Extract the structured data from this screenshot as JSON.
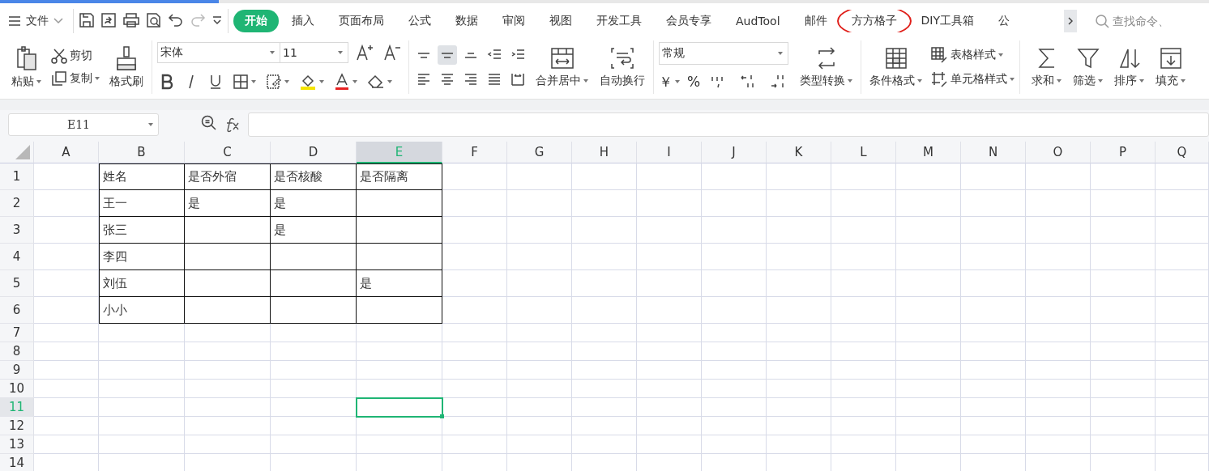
{
  "menu": {
    "label": "文件"
  },
  "tabs": [
    {
      "label": "开始",
      "selected": true
    },
    {
      "label": "插入",
      "selected": false
    },
    {
      "label": "页面布局",
      "selected": false
    },
    {
      "label": "公式",
      "selected": false
    },
    {
      "label": "数据",
      "selected": false
    },
    {
      "label": "审阅",
      "selected": false
    },
    {
      "label": "视图",
      "selected": false
    },
    {
      "label": "开发工具",
      "selected": false
    },
    {
      "label": "会员专享",
      "selected": false
    },
    {
      "label": "AudTool",
      "selected": false
    },
    {
      "label": "邮件",
      "selected": false
    },
    {
      "label": "方方格子",
      "selected": false,
      "circled": true
    },
    {
      "label": "DIY工具箱",
      "selected": false
    },
    {
      "label": "公",
      "selected": false
    }
  ],
  "search": {
    "placeholder": "查找命令、"
  },
  "ribbon": {
    "clipboard": {
      "paste": "粘贴",
      "cut": "剪切",
      "copy": "复制",
      "format_painter": "格式刷"
    },
    "font": {
      "name": "宋体",
      "size": "11"
    },
    "vertical_align": [
      {
        "selected": false
      },
      {
        "selected": true
      },
      {
        "selected": false
      }
    ],
    "alignment": {
      "merge": "合并居中",
      "wrap": "自动换行"
    },
    "number": {
      "format": "常规",
      "currency": "￥",
      "percent": "%",
      "convert": "类型转换"
    },
    "styles": {
      "conditional": "条件格式",
      "table_style": "表格样式",
      "cell_style": "单元格样式"
    },
    "editing": [
      "求和",
      "筛选",
      "排序",
      "填充"
    ]
  },
  "formula_bar": {
    "cell_ref": "E11"
  },
  "sheet": {
    "columns": [
      {
        "label": "A",
        "selected": false
      },
      {
        "label": "B",
        "selected": false
      },
      {
        "label": "C",
        "selected": false
      },
      {
        "label": "D",
        "selected": false
      },
      {
        "label": "E",
        "selected": true
      },
      {
        "label": "F",
        "selected": false
      },
      {
        "label": "G",
        "selected": false
      },
      {
        "label": "H",
        "selected": false
      },
      {
        "label": "I",
        "selected": false
      },
      {
        "label": "J",
        "selected": false
      },
      {
        "label": "K",
        "selected": false
      },
      {
        "label": "L",
        "selected": false
      },
      {
        "label": "M",
        "selected": false
      },
      {
        "label": "N",
        "selected": false
      },
      {
        "label": "O",
        "selected": false
      },
      {
        "label": "P",
        "selected": false
      },
      {
        "label": "Q",
        "selected": false
      }
    ],
    "rows": [
      {
        "label": "1",
        "selected": false,
        "cells": [
          "",
          "姓名",
          "是否外宿",
          "是否核酸",
          "是否隔离"
        ]
      },
      {
        "label": "2",
        "selected": false,
        "cells": [
          "",
          "王一",
          "是",
          "是",
          ""
        ]
      },
      {
        "label": "3",
        "selected": false,
        "cells": [
          "",
          "张三",
          "",
          "是",
          ""
        ]
      },
      {
        "label": "4",
        "selected": false,
        "cells": [
          "",
          "李四",
          "",
          "",
          ""
        ]
      },
      {
        "label": "5",
        "selected": false,
        "cells": [
          "",
          "刘伍",
          "",
          "",
          "是"
        ]
      },
      {
        "label": "6",
        "selected": false,
        "cells": [
          "",
          "小小",
          "",
          "",
          ""
        ]
      },
      {
        "label": "7",
        "selected": false
      },
      {
        "label": "8",
        "selected": false
      },
      {
        "label": "9",
        "selected": false
      },
      {
        "label": "10",
        "selected": false
      },
      {
        "label": "11",
        "selected": true
      },
      {
        "label": "12",
        "selected": false
      },
      {
        "label": "13",
        "selected": false
      },
      {
        "label": "14",
        "selected": false
      }
    ]
  }
}
